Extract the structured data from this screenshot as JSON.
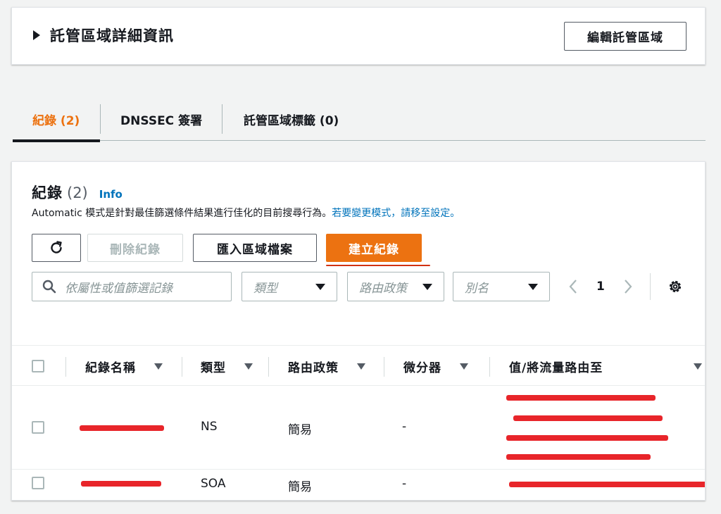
{
  "details": {
    "title": "託管區域詳細資訊",
    "edit_label": "編輯託管區域"
  },
  "tabs": [
    {
      "label": "紀錄 (2)"
    },
    {
      "label": "DNSSEC 簽署"
    },
    {
      "label": "託管區域標籤 (0)"
    }
  ],
  "records": {
    "title": "紀錄",
    "count": "(2)",
    "info": "Info",
    "desc_prefix": "Automatic 模式是針對最佳篩選條件結果進行佳化的目前搜尋行為。",
    "desc_link": "若要變更模式，請移至設定。",
    "actions": {
      "delete": "刪除紀錄",
      "import": "匯入區域檔案",
      "create": "建立紀錄"
    },
    "filters": {
      "search_placeholder": "依屬性或值篩選記錄",
      "type": "類型",
      "policy": "路由政策",
      "alias": "別名"
    },
    "page": "1",
    "columns": [
      "紀錄名稱",
      "類型",
      "路由政策",
      "微分器",
      "值/將流量路由至"
    ],
    "rows": [
      {
        "type": "NS",
        "policy": "簡易",
        "differentiator": "-"
      },
      {
        "type": "SOA",
        "policy": "簡易",
        "differentiator": "-"
      }
    ]
  },
  "colors": {
    "accent": "#ec7211",
    "link": "#0073bb",
    "redaction": "#e8252a"
  }
}
